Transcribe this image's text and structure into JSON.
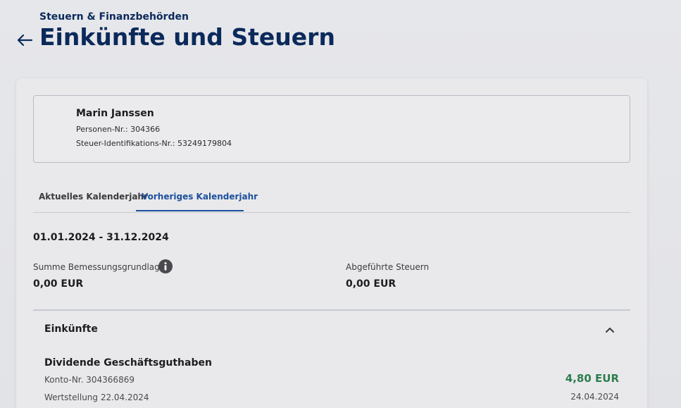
{
  "header": {
    "breadcrumb": "Steuern & Finanzbehörden",
    "title": "Einkünfte und Steuern",
    "back_icon": "arrow-left-icon"
  },
  "person": {
    "name": "Marin Janssen",
    "person_no": "Personen-Nr.: 304366",
    "tax_id": "Steuer-Identifikations-Nr.: 53249179804"
  },
  "tabs": [
    {
      "label": "Aktuelles Kalenderjahr",
      "active": false
    },
    {
      "label": "Vorheriges Kalenderjahr",
      "active": true
    }
  ],
  "summary": {
    "period": "01.01.2024 - 31.12.2024",
    "base_label": "Summe Bemessungsgrundlage",
    "base_value": "0,00 EUR",
    "base_info_icon": "info-icon",
    "taxes_label": "Abgeführte Steuern",
    "taxes_value": "0,00 EUR"
  },
  "income": {
    "section_title": "Einkünfte",
    "collapse_icon": "chevron-up-icon",
    "entries": [
      {
        "title": "Dividende Geschäftsguthaben",
        "account": "Konto-Nr. 304366869",
        "value_date": "Wertstellung 22.04.2024",
        "amount": "4,80 EUR",
        "date": "24.04.2024"
      }
    ]
  },
  "colors": {
    "brand_navy": "#0b2a5b",
    "tab_active": "#1c4f9c",
    "amount_positive": "#2e7d4f"
  }
}
